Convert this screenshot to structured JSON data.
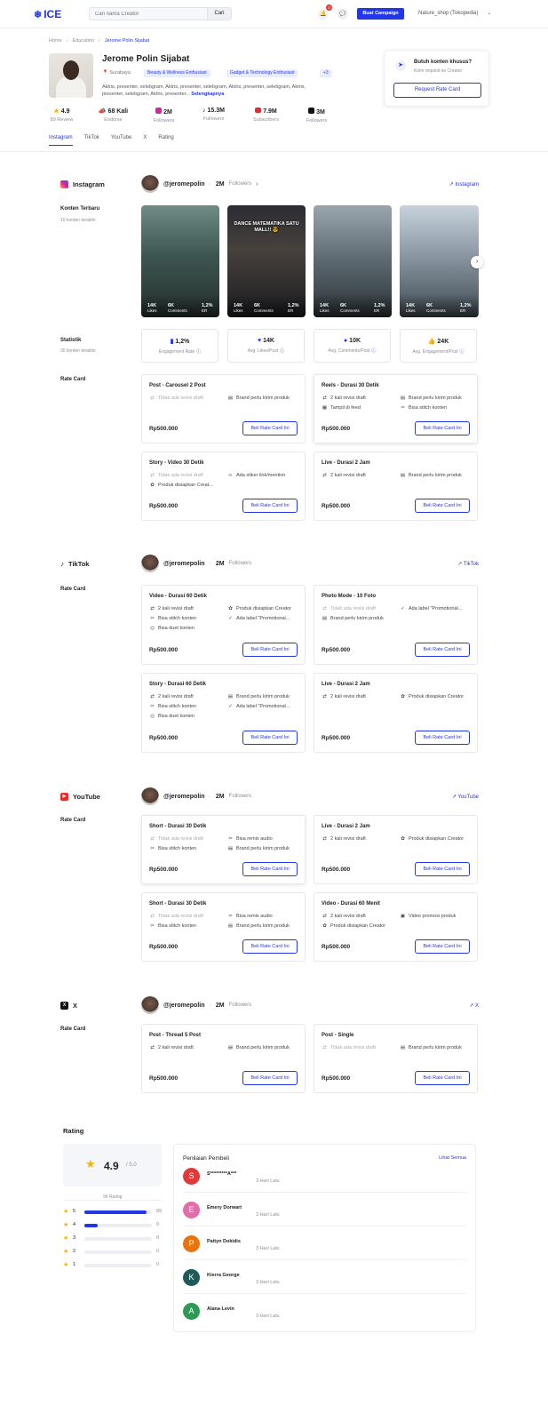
{
  "header": {
    "logo": "ICE",
    "search_placeholder": "Cari nama Creator",
    "search_button": "Cari",
    "notif_count": "3",
    "campaign_button": "Buat Campaign",
    "account": "Nature_shop (Tokopedia)"
  },
  "breadcrumb": [
    "Home",
    "Education",
    "Jerome Polin Sijabat"
  ],
  "profile": {
    "name": "Jerome Polin Sijabat",
    "location": "Surabaya",
    "tags": [
      "Beauty & Wellness Enthusiast",
      "Gadget & Technology Enthusiast",
      "+3"
    ],
    "description": "Aktris, presenter, selebgram, Aktris, presenter, selebgram, Aktris, presenter, selebgram, Aktris, presenter, selebgram, Aktris, presenter...",
    "read_more": "Selengkapnya",
    "stats": [
      {
        "value": "4.9",
        "label": "89 Review"
      },
      {
        "value": "68 Kali",
        "label": "Endorse"
      },
      {
        "value": "2M",
        "label": "Followers"
      },
      {
        "value": "15.3M",
        "label": "Followers"
      },
      {
        "value": "7.9M",
        "label": "Subscribers"
      },
      {
        "value": "3M",
        "label": "Followers"
      }
    ]
  },
  "request": {
    "title": "Butuh konten khusus?",
    "subtitle": "Kirim request ke Creator",
    "button": "Request Rate Card"
  },
  "tabs": [
    "Instagram",
    "TikTok",
    "YouTube",
    "X",
    "Rating"
  ],
  "labels": {
    "konten_terbaru": "Konten Terbaru",
    "konten_terbaru_sub": "10 konten terakhir",
    "statistik": "Statistik",
    "statistik_sub": "30 konten terakhir",
    "rate_card": "Rate Card",
    "buy": "Beli Rate Card Ini",
    "followers": "Followers"
  },
  "instagram": {
    "name": "Instagram",
    "handle": "@jeromepolin",
    "followers": "2M",
    "link": "Instagram",
    "posts": [
      {
        "likes": "14K",
        "comments": "6K",
        "er": "1,2%",
        "overlay": ""
      },
      {
        "likes": "14K",
        "comments": "6K",
        "er": "1,2%",
        "overlay": "DANCE MATEMATIKA SATU MALL!! 😎"
      },
      {
        "likes": "14K",
        "comments": "6K",
        "er": "1,2%",
        "overlay": ""
      },
      {
        "likes": "14K",
        "comments": "6K",
        "er": "1,2%",
        "overlay": ""
      }
    ],
    "post_labels": {
      "likes": "Likes",
      "comments": "Comments",
      "er": "ER"
    },
    "stats": [
      {
        "value": "1,2%",
        "label": "Engagement Rate"
      },
      {
        "value": "14K",
        "label": "Avg. Likes/Post"
      },
      {
        "value": "10K",
        "label": "Avg. Comments/Post"
      },
      {
        "value": "24K",
        "label": "Avg. Engagement/Post"
      }
    ],
    "cards": [
      {
        "title": "Post - Carousel 2 Post",
        "features": [
          "Tidak ada revisi draft",
          "Brand perlu kirim produk"
        ],
        "price": "Rp500.000"
      },
      {
        "title": "Reels - Durasi 30 Detik",
        "features": [
          "2 kali revisi draft",
          "Brand perlu kirim produk",
          "Tampil di feed",
          "Bisa stitch konten"
        ],
        "price": "Rp500.000"
      },
      {
        "title": "Story - Video 30 Detik",
        "features": [
          "Tidak ada revisi draft",
          "Ada stiker link/mention",
          "Produk disiapkan Creat..."
        ],
        "price": "Rp500.000"
      },
      {
        "title": "Live - Durasi 2 Jam",
        "features": [
          "2 kali revisi draft",
          "Brand perlu kirim produk"
        ],
        "price": "Rp500.000"
      }
    ]
  },
  "tiktok": {
    "name": "TikTok",
    "handle": "@jeromepolin",
    "followers": "2M",
    "link": "TikTok",
    "cards": [
      {
        "title": "Video - Durasi 60 Detik",
        "features": [
          "2 kali revisi draft",
          "Produk disiapkan Creator",
          "Bisa stitch konten",
          "Ada label \"Promotional...",
          "Bisa duet konten"
        ],
        "price": "Rp500.000"
      },
      {
        "title": "Photo Mode - 10 Foto",
        "features": [
          "Tidak ada revisi draft",
          "Ada label \"Promotional...",
          "Brand perlu kirim produk"
        ],
        "price": "Rp500.000"
      },
      {
        "title": "Story - Durasi 60 Detik",
        "features": [
          "2 kali revisi draft",
          "Brand perlu kirim produk",
          "Bisa stitch konten",
          "Ada label \"Promotional...",
          "Bisa duet konten"
        ],
        "price": "Rp500.000"
      },
      {
        "title": "Live - Durasi 2 Jam",
        "features": [
          "2 kali revisi draft",
          "Produk disiapkan Creator"
        ],
        "price": "Rp500.000"
      }
    ]
  },
  "youtube": {
    "name": "YouTube",
    "handle": "@jeromepolin",
    "followers": "2M",
    "link": "YouTube",
    "cards": [
      {
        "title": "Short - Durasi 30 Detik",
        "features": [
          "Tidak ada revisi draft",
          "Bisa remix audio",
          "Bisa stitch konten",
          "Brand perlu kirim produk"
        ],
        "price": "Rp500.000"
      },
      {
        "title": "Live - Durasi 2 Jam",
        "features": [
          "2 kali revisi draft",
          "Produk disiapkan Creator"
        ],
        "price": "Rp500.000"
      },
      {
        "title": "Short - Durasi 30 Detik",
        "features": [
          "Tidak ada revisi draft",
          "Bisa remix audio",
          "Bisa stitch konten",
          "Brand perlu kirim produk"
        ],
        "price": "Rp500.000"
      },
      {
        "title": "Video - Durasi 60 Menit",
        "features": [
          "2 kali revisi draft",
          "Video promosi produk",
          "Produk disiapkan Creator"
        ],
        "price": "Rp500.000"
      }
    ]
  },
  "x": {
    "name": "X",
    "handle": "@jeromepolin",
    "followers": "2M",
    "link": "X",
    "cards": [
      {
        "title": "Post - Thread 5 Post",
        "features": [
          "2 kali revisi draft",
          "Brand perlu kirim produk"
        ],
        "price": "Rp500.000"
      },
      {
        "title": "Post - Single",
        "features": [
          "Tidak ada revisi draft",
          "Brand perlu kirim produk"
        ],
        "price": "Rp500.000"
      }
    ]
  },
  "rating": {
    "title": "Rating",
    "score": "4.9",
    "max": "/ 5.0",
    "count_label": "96 Rating",
    "distribution": [
      {
        "star": "5",
        "count": "89",
        "fraction": 0.92
      },
      {
        "star": "4",
        "count": "9",
        "fraction": 0.2
      },
      {
        "star": "3",
        "count": "0",
        "fraction": 0
      },
      {
        "star": "2",
        "count": "0",
        "fraction": 0
      },
      {
        "star": "1",
        "count": "0",
        "fraction": 0
      }
    ],
    "reviews_title": "Penilaian Pembeli",
    "see_all": "Lihat Semua",
    "reviews": [
      {
        "initial": "S",
        "name": "S*********A***",
        "time": "3 Hari Lalu",
        "color": "#e0393a"
      },
      {
        "initial": "E",
        "name": "Emery Dorwart",
        "time": "3 Hari Lalu",
        "color": "#e26da8"
      },
      {
        "initial": "P",
        "name": "Paityn Dokidis",
        "time": "3 Hari Lalu",
        "color": "#e8740f"
      },
      {
        "initial": "K",
        "name": "Kierra George",
        "time": "3 Hari Lalu",
        "color": "#1f5a5a"
      },
      {
        "initial": "A",
        "name": "Alana Levin",
        "time": "3 Hari Lalu",
        "color": "#2e9a55"
      }
    ]
  }
}
